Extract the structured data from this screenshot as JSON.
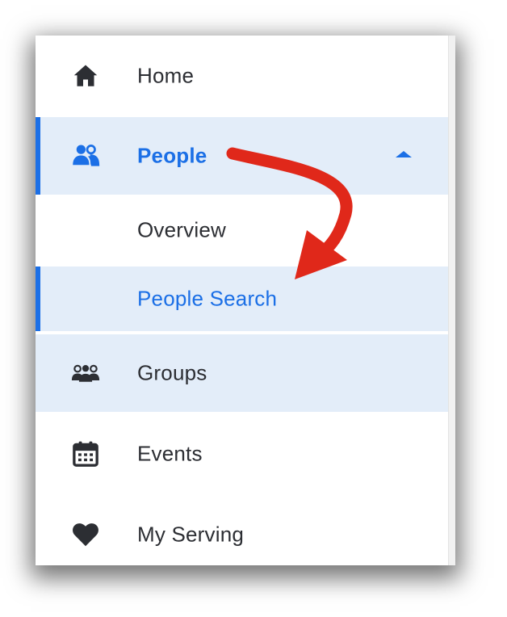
{
  "nav": {
    "home": {
      "label": "Home",
      "icon": "home-icon"
    },
    "people": {
      "label": "People",
      "icon": "people-icon",
      "expanded": true
    },
    "people_sub": {
      "overview": {
        "label": "Overview"
      },
      "search": {
        "label": "People Search"
      }
    },
    "groups": {
      "label": "Groups",
      "icon": "groups-icon"
    },
    "events": {
      "label": "Events",
      "icon": "calendar-icon"
    },
    "serving": {
      "label": "My Serving",
      "icon": "heart-icon"
    }
  },
  "colors": {
    "accent": "#1b6fe6",
    "active_bg": "#e3edf9",
    "text": "#2c2e33",
    "annotation_arrow": "#e0281a"
  }
}
